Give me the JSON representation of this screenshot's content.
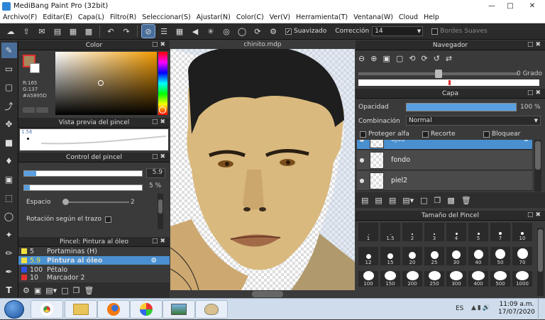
{
  "app": {
    "title": "MediBang Paint Pro (32bit)"
  },
  "menu": [
    "Archivo(F)",
    "Editar(E)",
    "Capa(L)",
    "Filtro(R)",
    "Seleccionar(S)",
    "Ajustar(N)",
    "Color(C)",
    "Ver(V)",
    "Herramienta(T)",
    "Ventana(W)",
    "Cloud",
    "Help"
  ],
  "toolbar": {
    "suavizado_label": "Suavizado",
    "correccion_label": "Corrección",
    "correccion_value": "14",
    "bordes_label": "Bordes Suaves"
  },
  "color_panel": {
    "title": "Color",
    "r": "R:165",
    "g": "G:137",
    "hex": "#A5895D",
    "primary_color": "#A5895D",
    "secondary_color": "#ffffff",
    "hue_base": "#f29a00"
  },
  "brush_preview": {
    "title": "Vista previa del pincel",
    "size_label": "1.56"
  },
  "brush_control": {
    "title": "Control del pincel",
    "size_value": "5.9",
    "opacity_value": "5 %",
    "size_fraction": 0.1,
    "opacity_fraction": 0.05,
    "espacio_label": "Espacio",
    "espacio_value": "2",
    "rotacion_label": "Rotación según el trazo"
  },
  "brush_list": {
    "title": "Pincel: Pintura al óleo",
    "items": [
      {
        "num": "5",
        "name": "Portaminas (H)",
        "color": "#f0e040"
      },
      {
        "num": "5.9",
        "name": "Pintura al óleo",
        "color": "#f0e040"
      },
      {
        "num": "100",
        "name": "Pétalo",
        "color": "#3050e0"
      },
      {
        "num": "10",
        "name": "Marcador 2",
        "color": "#e03030"
      }
    ]
  },
  "document": {
    "tab": "chinito.mdp"
  },
  "navigator": {
    "title": "Navegador",
    "angle": "0 Grado"
  },
  "capa": {
    "title": "Capa",
    "opacidad_label": "Opacidad",
    "opacidad_value": "100 %",
    "opacity_fraction": 1.0,
    "combinacion_label": "Combinación",
    "combinacion_value": "Normal",
    "proteger_label": "Proteger alfa",
    "recorte_label": "Recorte",
    "bloquear_label": "Bloquear",
    "layers": [
      {
        "name": "ojos"
      },
      {
        "name": "fondo"
      },
      {
        "name": "piel2"
      }
    ]
  },
  "brush_size": {
    "title": "Tamaño del Pincel",
    "rows": [
      [
        "1",
        "1.5",
        "2",
        "3",
        "4",
        "5",
        "7",
        "10"
      ],
      [
        "12",
        "15",
        "20",
        "25",
        "30",
        "40",
        "50",
        "70"
      ],
      [
        "100",
        "150",
        "200",
        "250",
        "300",
        "400",
        "500",
        "1000"
      ]
    ]
  },
  "taskbar": {
    "lang": "ES",
    "time": "11:09 a.m.",
    "date": "17/07/2020"
  }
}
